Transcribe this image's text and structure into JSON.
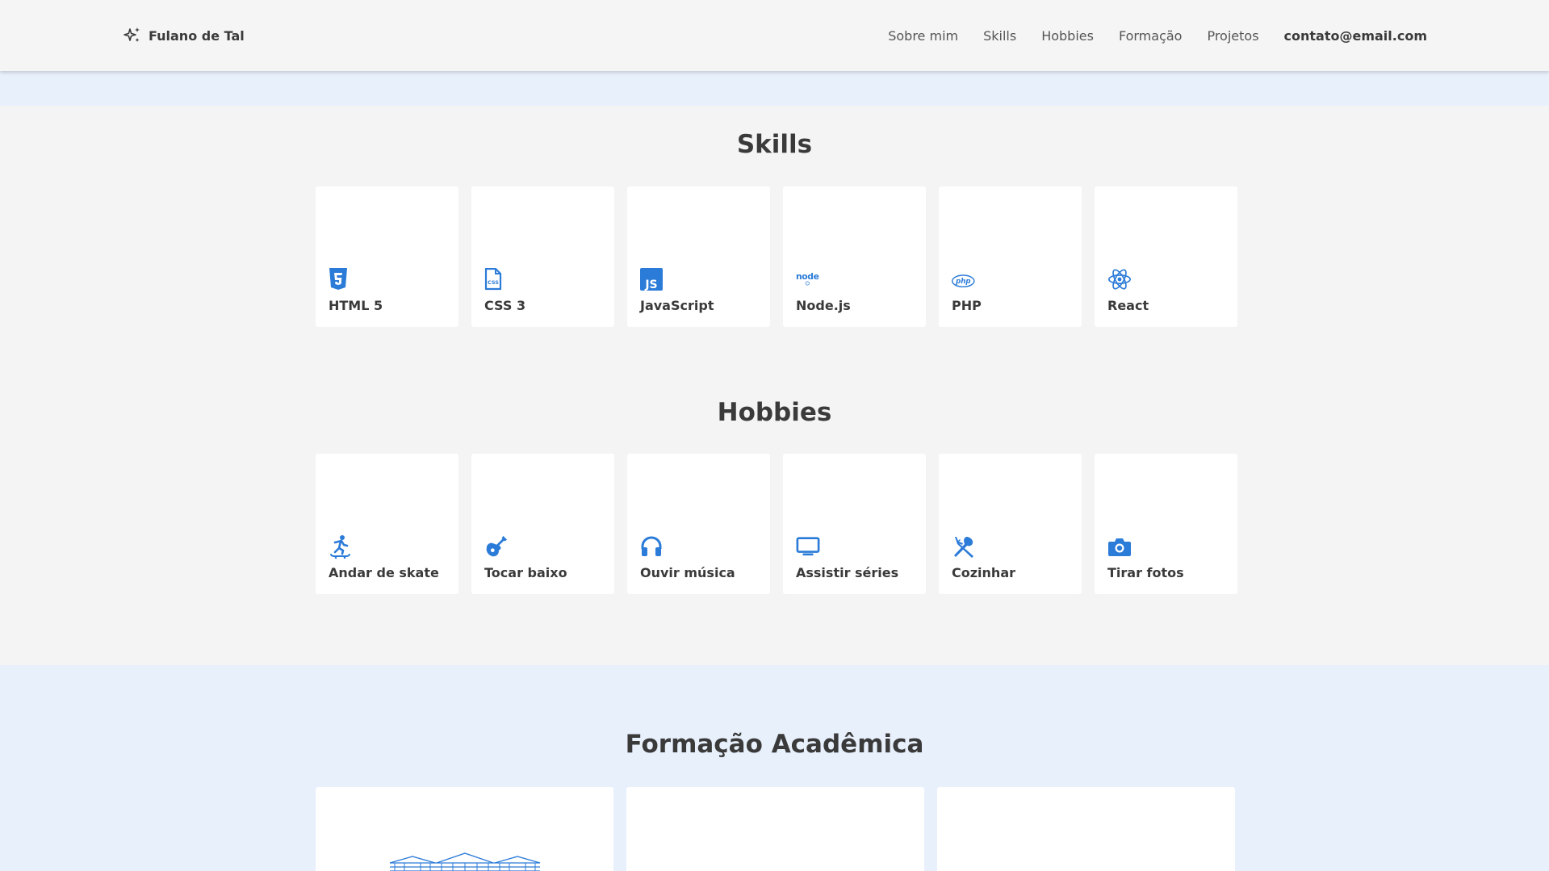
{
  "header": {
    "brand": "Fulano de Tal",
    "nav": [
      "Sobre mim",
      "Skills",
      "Hobbies",
      "Formação",
      "Projetos"
    ],
    "email": "contato@email.com"
  },
  "skills": {
    "title": "Skills",
    "items": [
      {
        "label": "HTML 5",
        "icon": "html5-icon"
      },
      {
        "label": "CSS 3",
        "icon": "css3-icon"
      },
      {
        "label": "JavaScript",
        "icon": "javascript-icon"
      },
      {
        "label": "Node.js",
        "icon": "nodejs-icon"
      },
      {
        "label": "PHP",
        "icon": "php-icon"
      },
      {
        "label": "React",
        "icon": "react-icon"
      }
    ]
  },
  "hobbies": {
    "title": "Hobbies",
    "items": [
      {
        "label": "Andar de skate",
        "icon": "skateboarding-icon"
      },
      {
        "label": "Tocar baixo",
        "icon": "guitar-icon"
      },
      {
        "label": "Ouvir música",
        "icon": "headphones-icon"
      },
      {
        "label": "Assistir séries",
        "icon": "tv-icon"
      },
      {
        "label": "Cozinhar",
        "icon": "utensils-icon"
      },
      {
        "label": "Tirar fotos",
        "icon": "camera-icon"
      }
    ]
  },
  "education": {
    "title": "Formação Acadêmica"
  },
  "colors": {
    "accent": "#2b7bd8",
    "text": "#3a3a3a",
    "band": "#e8f0fc",
    "background": "#f4f4f4",
    "card": "#ffffff"
  }
}
